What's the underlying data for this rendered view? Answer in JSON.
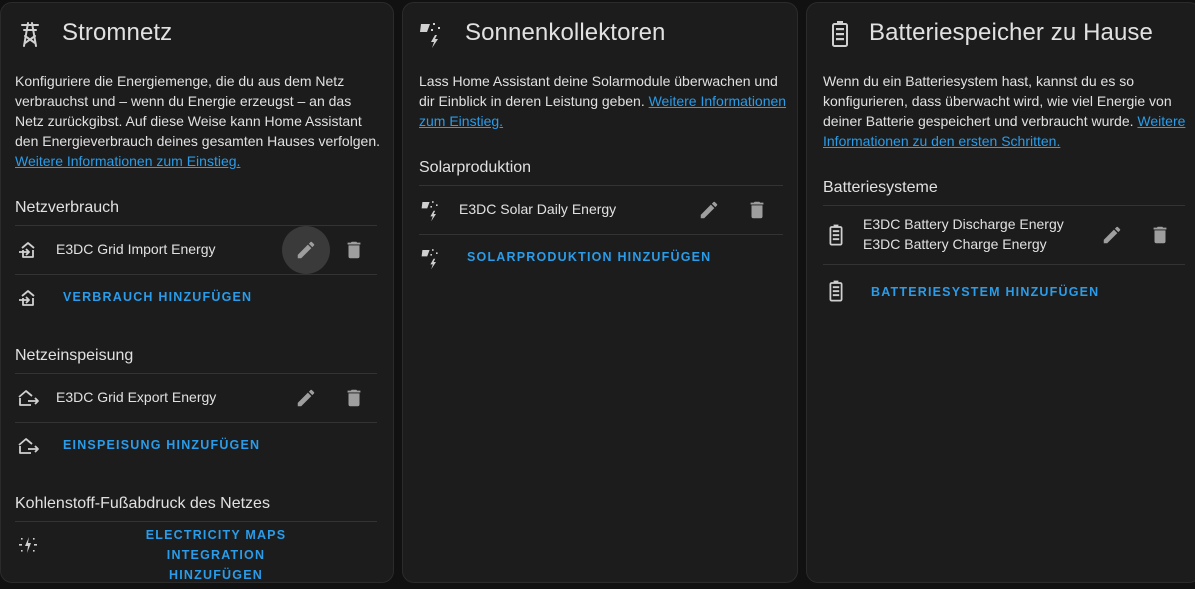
{
  "grid": {
    "title": "Stromnetz",
    "description": "Konfiguriere die Energiemenge, die du aus dem Netz verbrauchst und – wenn du Energie erzeugst – an das Netz zurückgibst. Auf diese Weise kann Home Assistant den Energieverbrauch deines gesamten Hauses verfolgen. ",
    "link": "Weitere Informationen zum Einstieg.",
    "consumption_title": "Netzverbrauch",
    "consumption_entity": "E3DC Grid Import Energy",
    "add_consumption": "VERBRAUCH HINZUFÜGEN",
    "return_title": "Netzeinspeisung",
    "return_entity": "E3DC Grid Export Energy",
    "add_return": "EINSPEISUNG HINZUFÜGEN",
    "co2_title": "Kohlenstoff-Fußabdruck des Netzes",
    "add_co2_line1": "ELECTRICITY MAPS INTEGRATION",
    "add_co2_line2": "HINZUFÜGEN"
  },
  "solar": {
    "title": "Sonnenkollektoren",
    "description": "Lass Home Assistant deine Solarmodule überwachen und dir Einblick in deren Leistung geben. ",
    "link": "Weitere Informationen zum Einstieg.",
    "production_title": "Solarproduktion",
    "production_entity": "E3DC Solar Daily Energy",
    "add_production": "SOLARPRODUKTION HINZUFÜGEN"
  },
  "battery": {
    "title": "Batteriespeicher zu Hause",
    "description": "Wenn du ein Batteriesystem hast, kannst du es so konfigurieren, dass überwacht wird, wie viel Energie von deiner Batterie gespeichert und verbraucht wurde. ",
    "link": "Weitere Informationen zu den ersten Schritten.",
    "systems_title": "Batteriesysteme",
    "discharge_entity": "E3DC Battery Discharge Energy",
    "charge_entity": "E3DC Battery Charge Energy",
    "add_system": "BATTERIESYSTEM HINZUFÜGEN"
  },
  "colors": {
    "background": "#111111",
    "card": "#1c1c1c",
    "accent": "#2a9ce9",
    "icon": "#9e9e9e",
    "text": "#e1e1e1"
  },
  "icons": [
    "transmission-tower-icon",
    "solar-power-icon",
    "battery-icon",
    "home-import-icon",
    "home-export-icon",
    "pencil-icon",
    "delete-icon",
    "carbon-leaf-icon"
  ]
}
